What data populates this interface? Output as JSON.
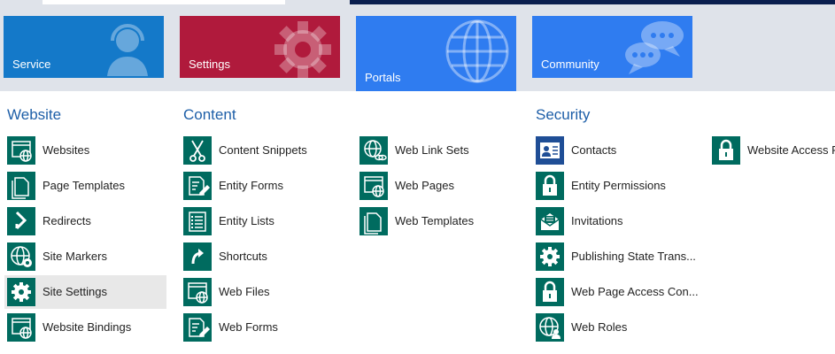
{
  "tiles": {
    "service": "Service",
    "settings": "Settings",
    "portals": "Portals",
    "community": "Community"
  },
  "sections": {
    "website": "Website",
    "content": "Content",
    "security": "Security"
  },
  "website_items": [
    "Websites",
    "Page Templates",
    "Redirects",
    "Site Markers",
    "Site Settings",
    "Website Bindings"
  ],
  "content_items": [
    "Content Snippets",
    "Entity Forms",
    "Entity Lists",
    "Shortcuts",
    "Web Files",
    "Web Forms"
  ],
  "content2_items": [
    "Web Link Sets",
    "Web Pages",
    "Web Templates"
  ],
  "security_items": [
    "Contacts",
    "Entity Permissions",
    "Invitations",
    "Publishing State Trans...",
    "Web Page Access Con...",
    "Web Roles"
  ],
  "security2_items": [
    "Website Access P"
  ],
  "selected_item": "Site Settings",
  "colors": {
    "service": "#1479c9",
    "settings": "#b01a3c",
    "portals": "#2f7cf0",
    "community": "#2f7cf0",
    "icon": "#006b5f",
    "section_title": "#1e5fa8"
  }
}
